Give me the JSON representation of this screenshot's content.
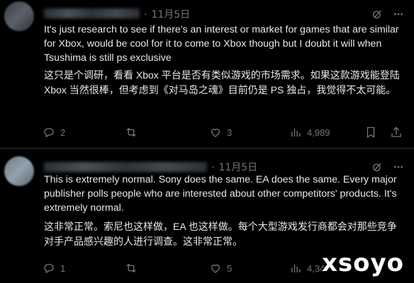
{
  "posts": [
    {
      "date": "11月5日",
      "body_en": "It's just research to see if there's an interest or market for games that are similar for Xbox, would be cool for it to come to Xbox though but I doubt it will when Tsushima is still ps exclusive",
      "body_cn": "这只是个调研，看看 Xbox 平台是否有类似游戏的市场需求。如果这款游戏能登陆 Xbox 当然很棒，但考虑到《对马岛之魂》目前仍是 PS 独占，我觉得不太可能。",
      "replies": "2",
      "reposts": "",
      "likes": "3",
      "views": "4,989"
    },
    {
      "date": "11月5日",
      "body_en": "This is extremely normal. Sony does the same. EA does the same. Every major publisher polls people who are interested about other competitors' products. It's extremely normal.",
      "body_cn": "这非常正常。索尼也这样做，EA 也这样做。每个大型游戏发行商都会对那些竞争对手产品感兴趣的人进行调查。这非常正常。",
      "replies": "1",
      "reposts": "",
      "likes": "5",
      "views": "4,344"
    }
  ],
  "watermark": "xsoyo",
  "icons": [
    "grok-icon",
    "more-icon",
    "reply-icon",
    "repost-icon",
    "like-icon",
    "views-icon",
    "bookmark-icon",
    "share-icon"
  ]
}
